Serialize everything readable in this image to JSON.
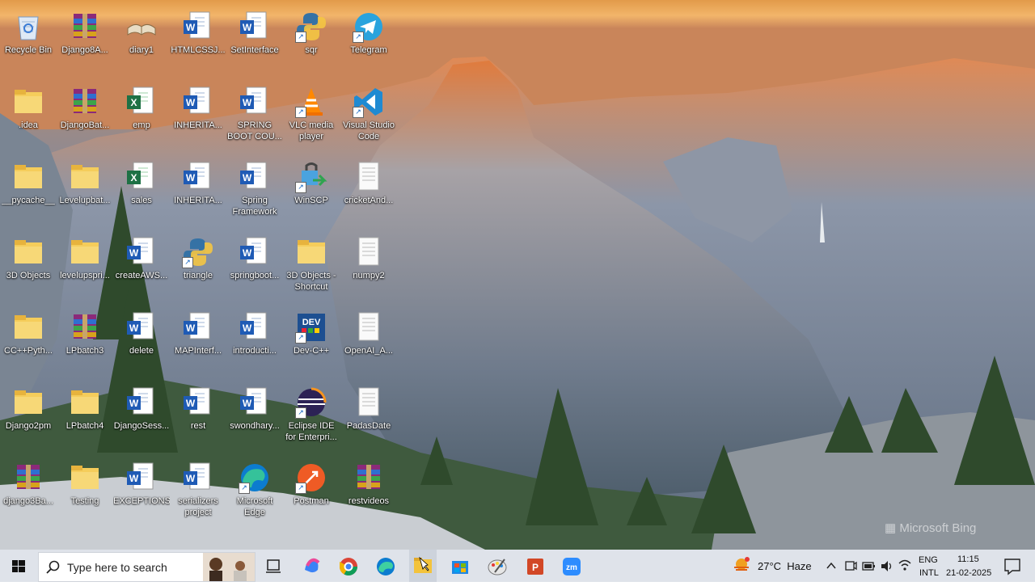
{
  "desktop": {
    "icons": [
      {
        "label": "Recycle Bin",
        "glyph": "recycle-bin"
      },
      {
        "label": "Django8A...",
        "glyph": "winrar"
      },
      {
        "label": "diary1",
        "glyph": "diary"
      },
      {
        "label": "HTMLCSSJ...",
        "glyph": "word"
      },
      {
        "label": "SetInterface",
        "glyph": "word"
      },
      {
        "label": "sqr",
        "glyph": "python"
      },
      {
        "label": "Telegram",
        "glyph": "telegram"
      },
      {
        "label": ".idea",
        "glyph": "folder"
      },
      {
        "label": "DjangoBat...",
        "glyph": "winrar"
      },
      {
        "label": "emp",
        "glyph": "excel"
      },
      {
        "label": "INHERITA...",
        "glyph": "word"
      },
      {
        "label": "SPRING BOOT COU...",
        "glyph": "word"
      },
      {
        "label": "VLC media player",
        "glyph": "vlc"
      },
      {
        "label": "Visual Studio Code",
        "glyph": "vscode"
      },
      {
        "label": "__pycache__",
        "glyph": "folder"
      },
      {
        "label": "Levelupbat...",
        "glyph": "folder"
      },
      {
        "label": "sales",
        "glyph": "excel"
      },
      {
        "label": "INHERITA...",
        "glyph": "word"
      },
      {
        "label": "Spring Framework",
        "glyph": "word"
      },
      {
        "label": "WinSCP",
        "glyph": "winscp"
      },
      {
        "label": "cricketAnd...",
        "glyph": "text"
      },
      {
        "label": "3D Objects",
        "glyph": "folder"
      },
      {
        "label": "levelupspri...",
        "glyph": "folder"
      },
      {
        "label": "createAWS...",
        "glyph": "word"
      },
      {
        "label": "triangle",
        "glyph": "python"
      },
      {
        "label": "springboot...",
        "glyph": "word"
      },
      {
        "label": "3D Objects - Shortcut",
        "glyph": "folder"
      },
      {
        "label": "numpy2",
        "glyph": "text"
      },
      {
        "label": "CC++Pyth...",
        "glyph": "folder"
      },
      {
        "label": "LPbatch3",
        "glyph": "winrar"
      },
      {
        "label": "delete",
        "glyph": "word"
      },
      {
        "label": "MAPInterf...",
        "glyph": "word"
      },
      {
        "label": "introducti...",
        "glyph": "word"
      },
      {
        "label": "Dev-C++",
        "glyph": "devcpp"
      },
      {
        "label": "OpenAI_A...",
        "glyph": "text"
      },
      {
        "label": "Django2pm",
        "glyph": "folder"
      },
      {
        "label": "LPbatch4",
        "glyph": "folder"
      },
      {
        "label": "DjangoSess...",
        "glyph": "word"
      },
      {
        "label": "rest",
        "glyph": "word"
      },
      {
        "label": "swondhary...",
        "glyph": "word"
      },
      {
        "label": "Eclipse IDE for Enterpri...",
        "glyph": "eclipse"
      },
      {
        "label": "PadasDate",
        "glyph": "text"
      },
      {
        "label": "django3Ba...",
        "glyph": "winrar"
      },
      {
        "label": "Testing",
        "glyph": "folder"
      },
      {
        "label": "EXCEPTIONS",
        "glyph": "word"
      },
      {
        "label": "serializers project",
        "glyph": "word"
      },
      {
        "label": "Microsoft Edge",
        "glyph": "edge"
      },
      {
        "label": "Postman",
        "glyph": "postman"
      },
      {
        "label": "restvideos",
        "glyph": "winrar"
      }
    ],
    "watermark": "Microsoft Bing"
  },
  "taskbar": {
    "search_placeholder": "Type here to search",
    "weather": "27°C  Haze",
    "lang1": "ENG",
    "lang2": "INTL",
    "time": "11:15",
    "date": "21-02-2025"
  }
}
